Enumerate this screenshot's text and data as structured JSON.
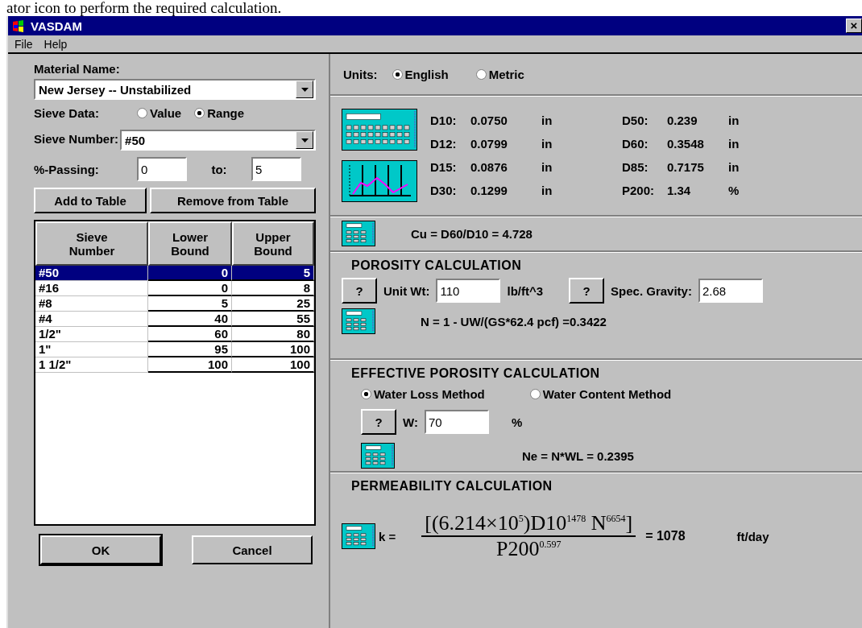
{
  "doc_text": "ator icon to perform the required calculation.",
  "window": {
    "title": "VASDAM",
    "close": "×",
    "menu": [
      "File",
      "Help"
    ]
  },
  "left": {
    "material_label": "Material Name:",
    "material_value": "New Jersey -- Unstabilized",
    "sieve_data_label": "Sieve Data:",
    "sieve_data_options": [
      {
        "label": "Value",
        "selected": false
      },
      {
        "label": "Range",
        "selected": true
      }
    ],
    "sieve_number_label": "Sieve Number:",
    "sieve_number_value": "#50",
    "passing_label": "%-Passing:",
    "passing_from": "0",
    "to_label": "to:",
    "passing_to": "5",
    "buttons": [
      "Add to Table",
      "Remove from Table"
    ],
    "table": {
      "columns": [
        "Sieve Number",
        "Lower Bound",
        "Upper Bound"
      ],
      "rows": [
        {
          "cells": [
            "#50",
            "0",
            "5"
          ],
          "selected": true
        },
        {
          "cells": [
            "#16",
            "0",
            "8"
          ],
          "selected": false
        },
        {
          "cells": [
            "#8",
            "5",
            "25"
          ],
          "selected": false
        },
        {
          "cells": [
            "#4",
            "40",
            "55"
          ],
          "selected": false
        },
        {
          "cells": [
            "1/2\"",
            "60",
            "80"
          ],
          "selected": false
        },
        {
          "cells": [
            "1\"",
            "95",
            "100"
          ],
          "selected": false
        },
        {
          "cells": [
            "1 1/2\"",
            "100",
            "100"
          ],
          "selected": false
        }
      ]
    },
    "ok": "OK",
    "cancel": "Cancel"
  },
  "right": {
    "units_label": "Units:",
    "units_options": [
      {
        "label": "English",
        "selected": true
      },
      {
        "label": "Metric",
        "selected": false
      }
    ],
    "results": [
      {
        "label": "D10:",
        "value": "0.0750",
        "unit": "in"
      },
      {
        "label": "D50:",
        "value": "0.239",
        "unit": "in"
      },
      {
        "label": "D12:",
        "value": "0.0799",
        "unit": "in"
      },
      {
        "label": "D60:",
        "value": "0.3548",
        "unit": "in"
      },
      {
        "label": "D15:",
        "value": "0.0876",
        "unit": "in"
      },
      {
        "label": "D85:",
        "value": "0.7175",
        "unit": "in"
      },
      {
        "label": "D30:",
        "value": "0.1299",
        "unit": "in"
      },
      {
        "label": "P200:",
        "value": "1.34",
        "unit": "%"
      }
    ],
    "cu": "Cu = D60/D10 =   4.728",
    "porosity": {
      "title": "POROSITY CALCULATION",
      "help": "?",
      "unit_wt_label": "Unit Wt:",
      "unit_wt_value": "110",
      "unit_wt_unit": "lb/ft^3",
      "help2": "?",
      "gs_label": "Spec. Gravity:",
      "gs_value": "2.68",
      "result": "N = 1 - UW/(GS*62.4 pcf) =0.3422"
    },
    "effective": {
      "title": "EFFECTIVE POROSITY CALCULATION",
      "methods": [
        {
          "label": "Water Loss Method",
          "selected": true
        },
        {
          "label": "Water Content Method",
          "selected": false
        }
      ],
      "help": "?",
      "w_label": "W:",
      "w_value": "70",
      "w_unit": "%",
      "result": "Ne = N*WL = 0.2395"
    },
    "permeability": {
      "title": "PERMEABILITY CALCULATION",
      "k_label": "k =",
      "numerator": "[(6.214×10$^{5}$)D10$^{1478}$ N$^{6654}$]",
      "denominator": "P200$^{0.597}$",
      "result": "= 1078",
      "unit": "ft/day"
    }
  }
}
